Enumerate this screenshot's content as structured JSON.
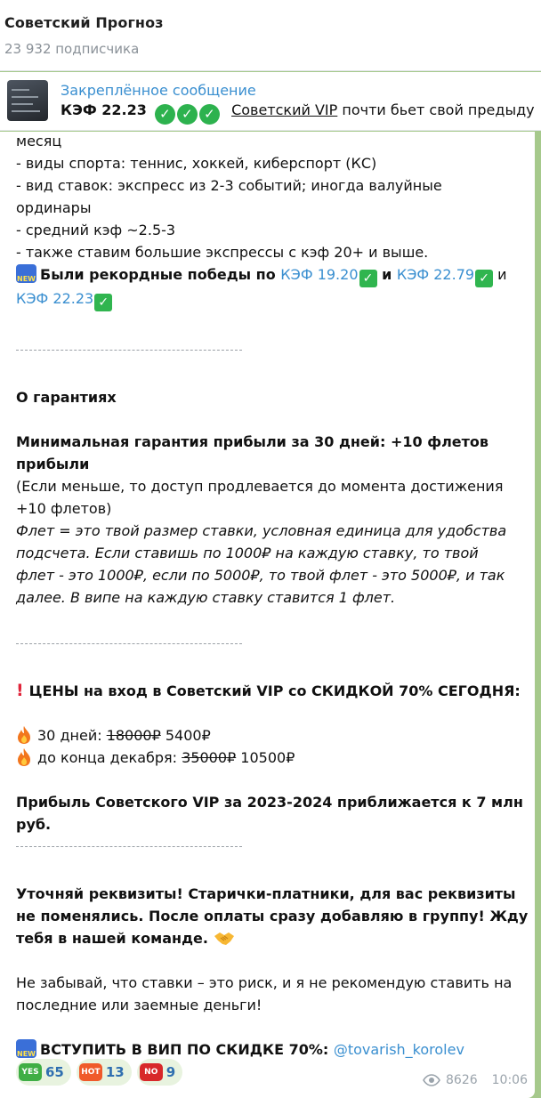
{
  "header": {
    "title": "Советский Прогноз",
    "subscribers": "23 932 подписчика"
  },
  "pinned": {
    "title": "Закреплённое сообщение",
    "kef": "КЭФ 22.23",
    "link": "Советский VIP",
    "rest": " почти бьет свой предыду"
  },
  "message": {
    "l1": "месяц",
    "l2": "- виды спорта: теннис, хоккей, киберспорт (КС)",
    "l3": "- вид ставок: экспресс из 2-3 событий; иногда валуйные",
    "l4": "ординары",
    "l5": "- средний кэф ~2.5-3",
    "l6": "- также ставим большие экспрессы с кэф 20+ и выше.",
    "records_prefix": "Были рекордные победы по ",
    "kef1": "КЭФ 19.20",
    "and1": " и ",
    "kef2": "КЭФ 22.79",
    "and2": " и",
    "kef3": "КЭФ 22.23",
    "guarantee_title": "О гарантиях",
    "min_guarantee_1": "Минимальная гарантия прибыли за 30 дней: +10 флетов",
    "min_guarantee_2": "прибыли",
    "note_1": "(Если меньше, то доступ продлевается до момента достижения",
    "note_2": "+10 флетов)",
    "flet_1": "Флет = это твой размер ставки, условная единица для удобства",
    "flet_2": "подсчета. Если ставишь по 1000₽ на каждую ставку, то твой",
    "flet_3": "флет - это 1000₽, если по 5000₽, то твой флет - это 5000₽, и так",
    "flet_4": "далее. В випе на каждую ставку ставится 1 флет.",
    "prices_title": "ЦЕНЫ на вход в Советский VIP со СКИДКОЙ 70% СЕГОДНЯ:",
    "price1_label": "30 дней: ",
    "price1_old": "18000₽",
    "price1_new": " 5400₽",
    "price2_label": "до конца декабря: ",
    "price2_old": "35000₽",
    "price2_new": " 10500₽",
    "profit_1": "Прибыль Советского VIP за 2023-2024 приближается к 7 млн",
    "profit_2": "руб.",
    "req_1": "Уточняй реквизиты! Старички-платники, для вас реквизиты",
    "req_2": "не поменялись. После оплаты сразу добавляю в группу! Жду",
    "req_3": "тебя в нашей команде.",
    "risk_1": "Не забывай, что ставки – это риск, и я не рекомендую ставить на",
    "risk_2": "последние или заемные деньги!",
    "join_label": "ВСТУПИТЬ В ВИП ПО СКИДКЕ 70%: ",
    "join_link": "@tovarish_korolev"
  },
  "reactions": [
    {
      "badge": "YES",
      "count": "65"
    },
    {
      "badge": "HOT",
      "count": "13"
    },
    {
      "badge": "NO",
      "count": "9"
    }
  ],
  "meta": {
    "views": "8626",
    "time": "10:06"
  },
  "colors": {
    "background": "#a6c98c",
    "link": "#3a8fd0",
    "check": "#30b54f"
  }
}
